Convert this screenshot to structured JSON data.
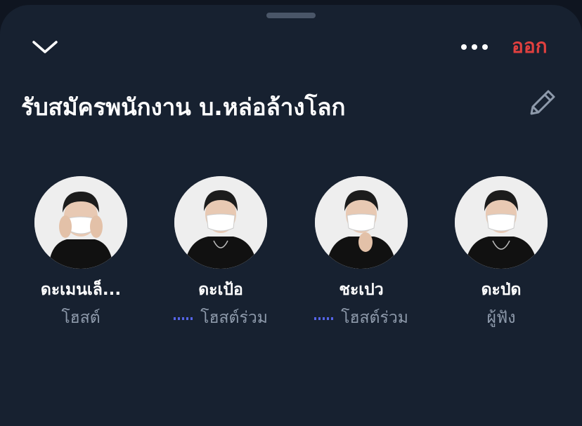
{
  "space": {
    "title": "รับสมัครพนักงาน บ.หล่อล้างโลก",
    "leave_label": "ออก"
  },
  "colors": {
    "background": "#172130",
    "leave": "#e0403f",
    "speaking": "#5565e8"
  },
  "icons": {
    "collapse": "chevron-down-icon",
    "more": "more-dots-icon",
    "edit": "pencil-icon",
    "speaking": "speaking-indicator-icon"
  },
  "participants": [
    {
      "name": "ดะเมนเล็...",
      "role": "โฮสต์",
      "speaking": false
    },
    {
      "name": "ดะเป้อ",
      "role": "โฮสต์ร่วม",
      "speaking": true
    },
    {
      "name": "ชะเปว",
      "role": "โฮสต์ร่วม",
      "speaking": true
    },
    {
      "name": "ดะป่ด",
      "role": "ผู้ฟัง",
      "speaking": false
    }
  ]
}
